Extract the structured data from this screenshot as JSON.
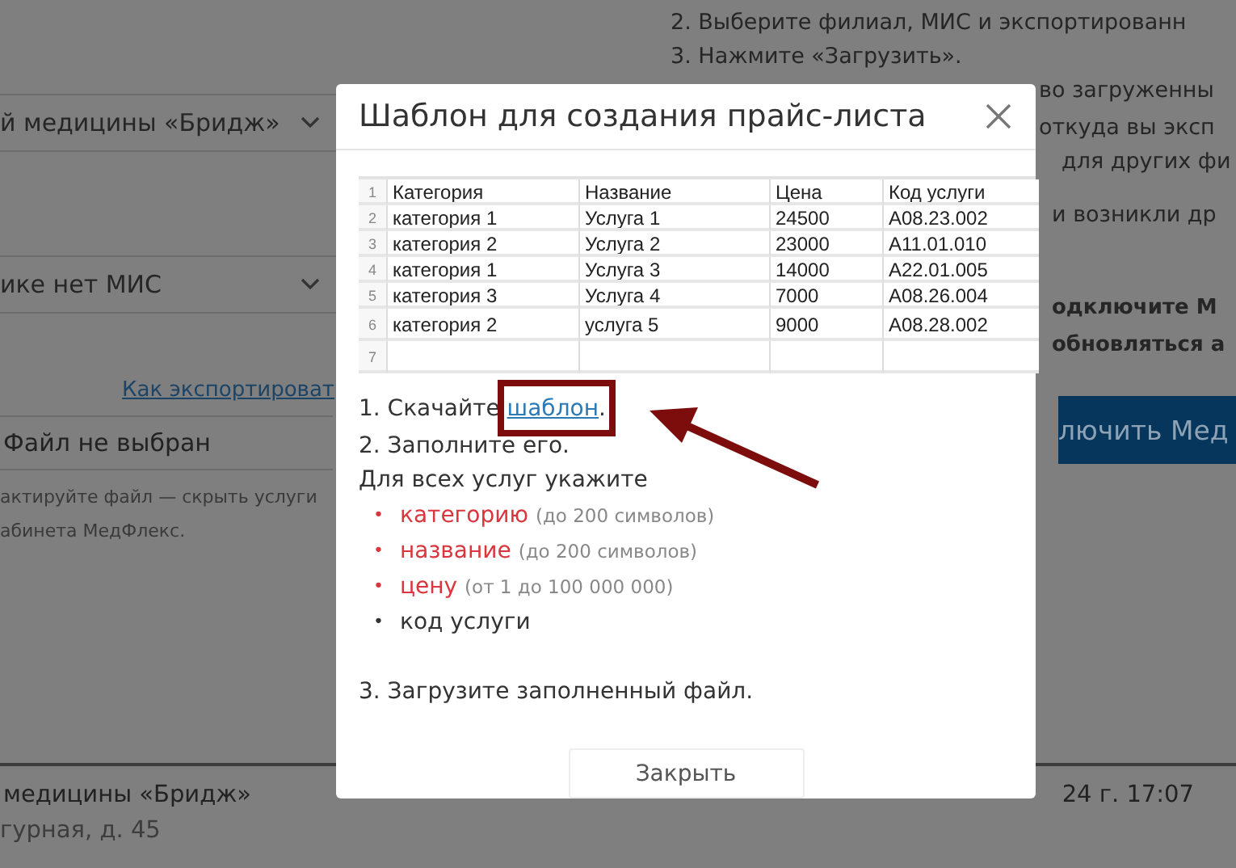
{
  "page": {
    "left": {
      "branch_select": {
        "value": "й медицины «Бридж»"
      },
      "mis_select": {
        "value": "ике нет МИС"
      },
      "export_link": "Как экспортироват",
      "file_field": {
        "value": "Файл не выбран"
      },
      "notes": [
        "актируйте файл — скрыть услуги",
        "абинета МедФлекс."
      ]
    },
    "right": {
      "steps": [
        "2. Выберите филиал, МИС и экспортированн",
        "3. Нажмите «Загрузить»."
      ],
      "fragments": [
        "во загруженны",
        "откуда вы эксп",
        "для других фи",
        "и возникли др"
      ],
      "bold_fragments": [
        "одключите М",
        "обновляться а"
      ],
      "connect_button": "лючить Мед"
    },
    "footer": {
      "clinic": "медицины «Бридж»",
      "address": "гурная, д. 45",
      "date": "24 г. 17:07"
    }
  },
  "modal": {
    "title": "Шаблон для создания прайс-листа",
    "sheet": {
      "row_numbers": [
        "1",
        "2",
        "3",
        "4",
        "5",
        "6",
        "7"
      ],
      "columns": [
        "Категория",
        "Название",
        "Цена",
        "Код услуги"
      ],
      "rows": [
        [
          "категория 1",
          "Услуга 1",
          "24500",
          "A08.23.002"
        ],
        [
          "категория 2",
          "Услуга 2",
          "23000",
          "A11.01.010"
        ],
        [
          "категория 1",
          "Услуга 3",
          "14000",
          "A22.01.005"
        ],
        [
          "категория 3",
          "Услуга 4",
          "7000",
          "A08.26.004"
        ],
        [
          "категория 2",
          "услуга 5",
          "9000",
          "A08.28.002"
        ]
      ]
    },
    "step1": {
      "text": "1. Скачайте",
      "link": "шаблон",
      "end": "."
    },
    "step2": "2. Заполните его.",
    "fields_intro": "Для всех услуг укажите",
    "fields": [
      {
        "bullet": "•",
        "name": "категорию",
        "note": "(до 200 символов)",
        "required": true
      },
      {
        "bullet": "•",
        "name": "название",
        "note": "(до 200 символов)",
        "required": true
      },
      {
        "bullet": "•",
        "name": "цену",
        "note": "(от 1 до 100 000 000)",
        "required": true
      },
      {
        "bullet": "•",
        "name": "код услуги",
        "required": false
      }
    ],
    "step3": "3. Загрузите заполненный файл.",
    "close_button": "Закрыть"
  }
}
